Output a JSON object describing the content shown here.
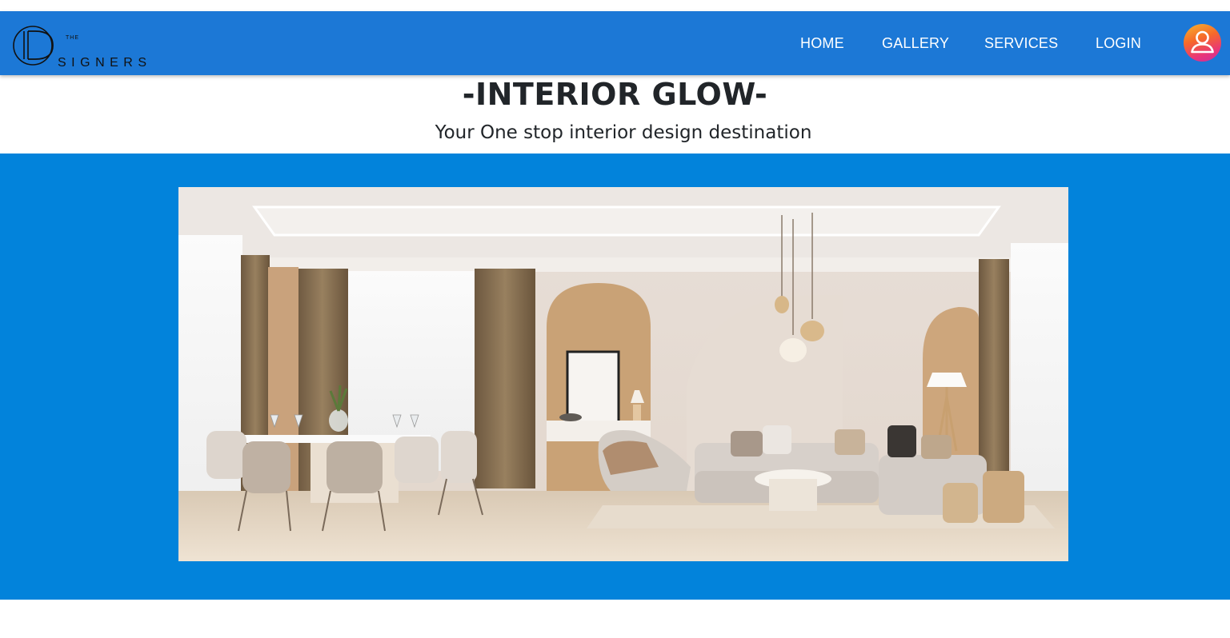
{
  "brand": {
    "logo_text": "THE DESIGNERS"
  },
  "nav": {
    "items": [
      {
        "label": "HOME"
      },
      {
        "label": "GALLERY"
      },
      {
        "label": "SERVICES"
      },
      {
        "label": "LOGIN"
      }
    ],
    "profile_icon": "user-icon"
  },
  "hero": {
    "title": "-INTERIOR GLOW-",
    "subtitle": "Your One stop interior design destination"
  },
  "colors": {
    "navbar": "#1c78d6",
    "banner": "#0283db",
    "text": "#212529"
  }
}
